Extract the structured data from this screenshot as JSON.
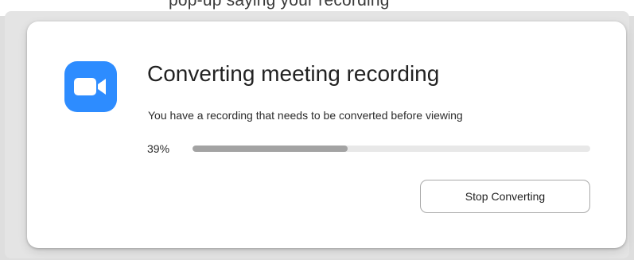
{
  "background_text": "pop-up saying your recording",
  "dialog": {
    "icon": "zoom-video-camera-icon",
    "title": "Converting meeting recording",
    "message": "You have a recording that needs to be converted before viewing",
    "progress": {
      "percent_label": "39%",
      "value": 0.39
    },
    "stop_button_label": "Stop Converting"
  },
  "colors": {
    "accent": "#2d8cff",
    "progress_fill": "#a3a3a3",
    "progress_track": "#e8e8e8"
  }
}
